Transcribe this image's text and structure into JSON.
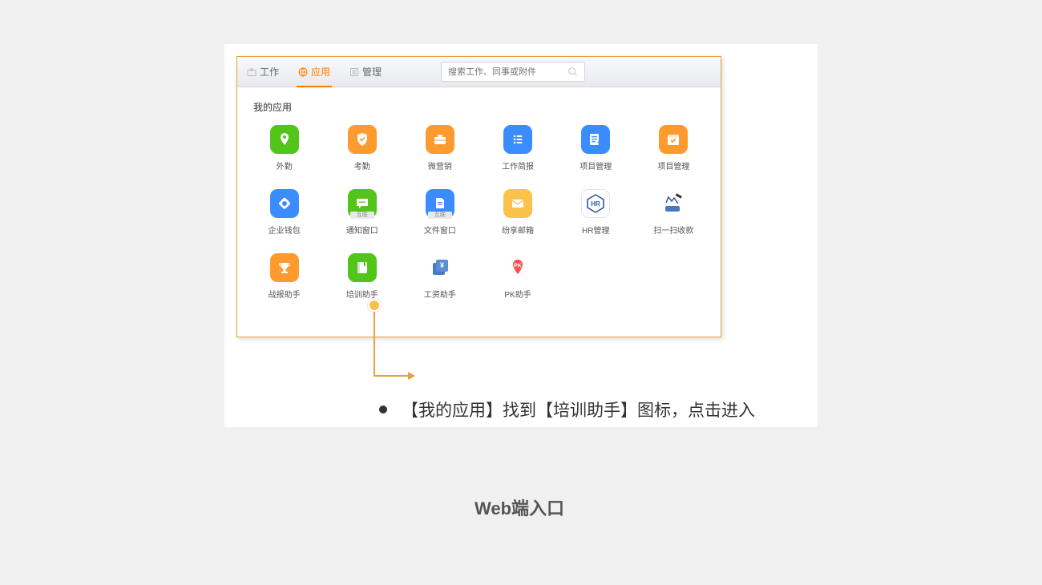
{
  "tabs": {
    "work": "工作",
    "apps": "应用",
    "manage": "管理"
  },
  "search": {
    "placeholder": "搜索工作、同事或附件"
  },
  "panel": {
    "title": "我的应用"
  },
  "apps": [
    {
      "label": "外勤"
    },
    {
      "label": "考勤"
    },
    {
      "label": "微营销"
    },
    {
      "label": "工作简报"
    },
    {
      "label": "项目管理"
    },
    {
      "label": "项目管理"
    },
    {
      "label": "企业钱包"
    },
    {
      "label": "通知窗口",
      "badge": "互联"
    },
    {
      "label": "文件窗口",
      "badge": "互联"
    },
    {
      "label": "纷享邮箱"
    },
    {
      "label": "HR管理"
    },
    {
      "label": "扫一扫收款"
    },
    {
      "label": "战报助手"
    },
    {
      "label": "培训助手"
    },
    {
      "label": "工资助手"
    },
    {
      "label": "PK助手"
    }
  ],
  "callout": {
    "text": "【我的应用】找到【培训助手】图标，点击进入"
  },
  "caption": "Web端入口"
}
